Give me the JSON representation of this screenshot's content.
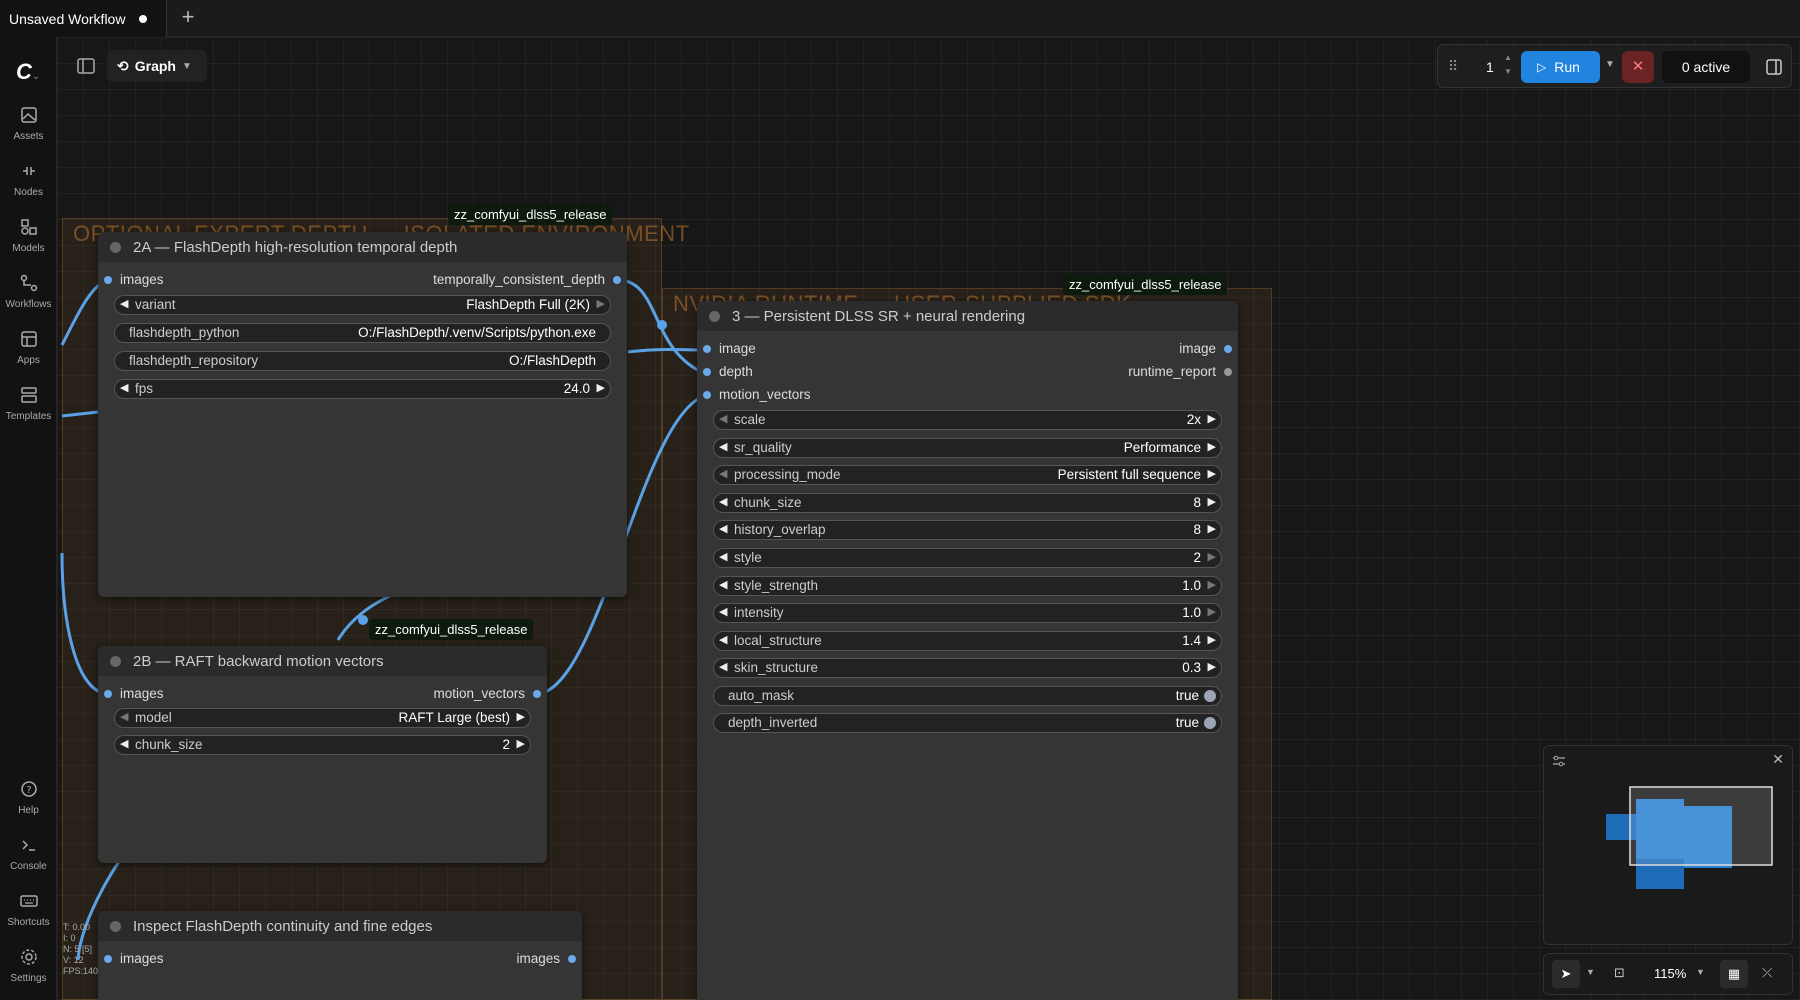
{
  "tab": {
    "title": "Unsaved Workflow"
  },
  "sidebar": [
    {
      "label": "Assets",
      "icon": "image-icon"
    },
    {
      "label": "Nodes",
      "icon": "plug-icon"
    },
    {
      "label": "Models",
      "icon": "cube-icon"
    },
    {
      "label": "Workflows",
      "icon": "flow-icon"
    },
    {
      "label": "Apps",
      "icon": "layout-icon"
    },
    {
      "label": "Templates",
      "icon": "template-icon"
    },
    {
      "label": "Help",
      "icon": "question-icon"
    },
    {
      "label": "Console",
      "icon": "terminal-icon"
    },
    {
      "label": "Shortcuts",
      "icon": "keyboard-icon"
    },
    {
      "label": "Settings",
      "icon": "gear-icon"
    }
  ],
  "toolbar": {
    "graph_label": "Graph",
    "queue_count": "1",
    "run_label": "Run",
    "active_label": "0 active"
  },
  "groups": {
    "g1_title": "OPTIONAL EXPERT DEPTH — ISOLATED ENVIRONMENT",
    "g2_title": "NVIDIA RUNTIME — USER-SUPPLIED SDK"
  },
  "badge_text": "zz_comfyui_dlss5_release",
  "node2a": {
    "title": "2A — FlashDepth high-resolution temporal depth",
    "input": "images",
    "output": "temporally_consistent_depth",
    "widgets": [
      {
        "label": "variant",
        "value": "FlashDepth Full (2K)"
      },
      {
        "label": "flashdepth_python",
        "value": "O:/FlashDepth/.venv/Scripts/python.exe"
      },
      {
        "label": "flashdepth_repository",
        "value": "O:/FlashDepth"
      },
      {
        "label": "fps",
        "value": "24.0"
      }
    ]
  },
  "node2b": {
    "title": "2B — RAFT backward motion vectors",
    "input": "images",
    "output": "motion_vectors",
    "widgets": [
      {
        "label": "model",
        "value": "RAFT Large (best)"
      },
      {
        "label": "chunk_size",
        "value": "2"
      }
    ]
  },
  "node_inspect": {
    "title": "Inspect FlashDepth continuity and fine edges",
    "input": "images",
    "output": "images"
  },
  "node3": {
    "title": "3 — Persistent DLSS SR + neural rendering",
    "inputs": [
      "image",
      "depth",
      "motion_vectors"
    ],
    "outputs": [
      "image",
      "runtime_report"
    ],
    "widgets": [
      {
        "label": "scale",
        "value": "2x"
      },
      {
        "label": "sr_quality",
        "value": "Performance"
      },
      {
        "label": "processing_mode",
        "value": "Persistent full sequence"
      },
      {
        "label": "chunk_size",
        "value": "8"
      },
      {
        "label": "history_overlap",
        "value": "8"
      },
      {
        "label": "style",
        "value": "2"
      },
      {
        "label": "style_strength",
        "value": "1.0"
      },
      {
        "label": "intensity",
        "value": "1.0"
      },
      {
        "label": "local_structure",
        "value": "1.4"
      },
      {
        "label": "skin_structure",
        "value": "0.3"
      },
      {
        "label": "auto_mask",
        "value": "true"
      },
      {
        "label": "depth_inverted",
        "value": "true"
      }
    ]
  },
  "zoom": "115%",
  "fps_info": [
    "T: 0.00",
    "I: 0",
    "N: 5 [5]",
    "V: 12",
    "FPS:140"
  ]
}
